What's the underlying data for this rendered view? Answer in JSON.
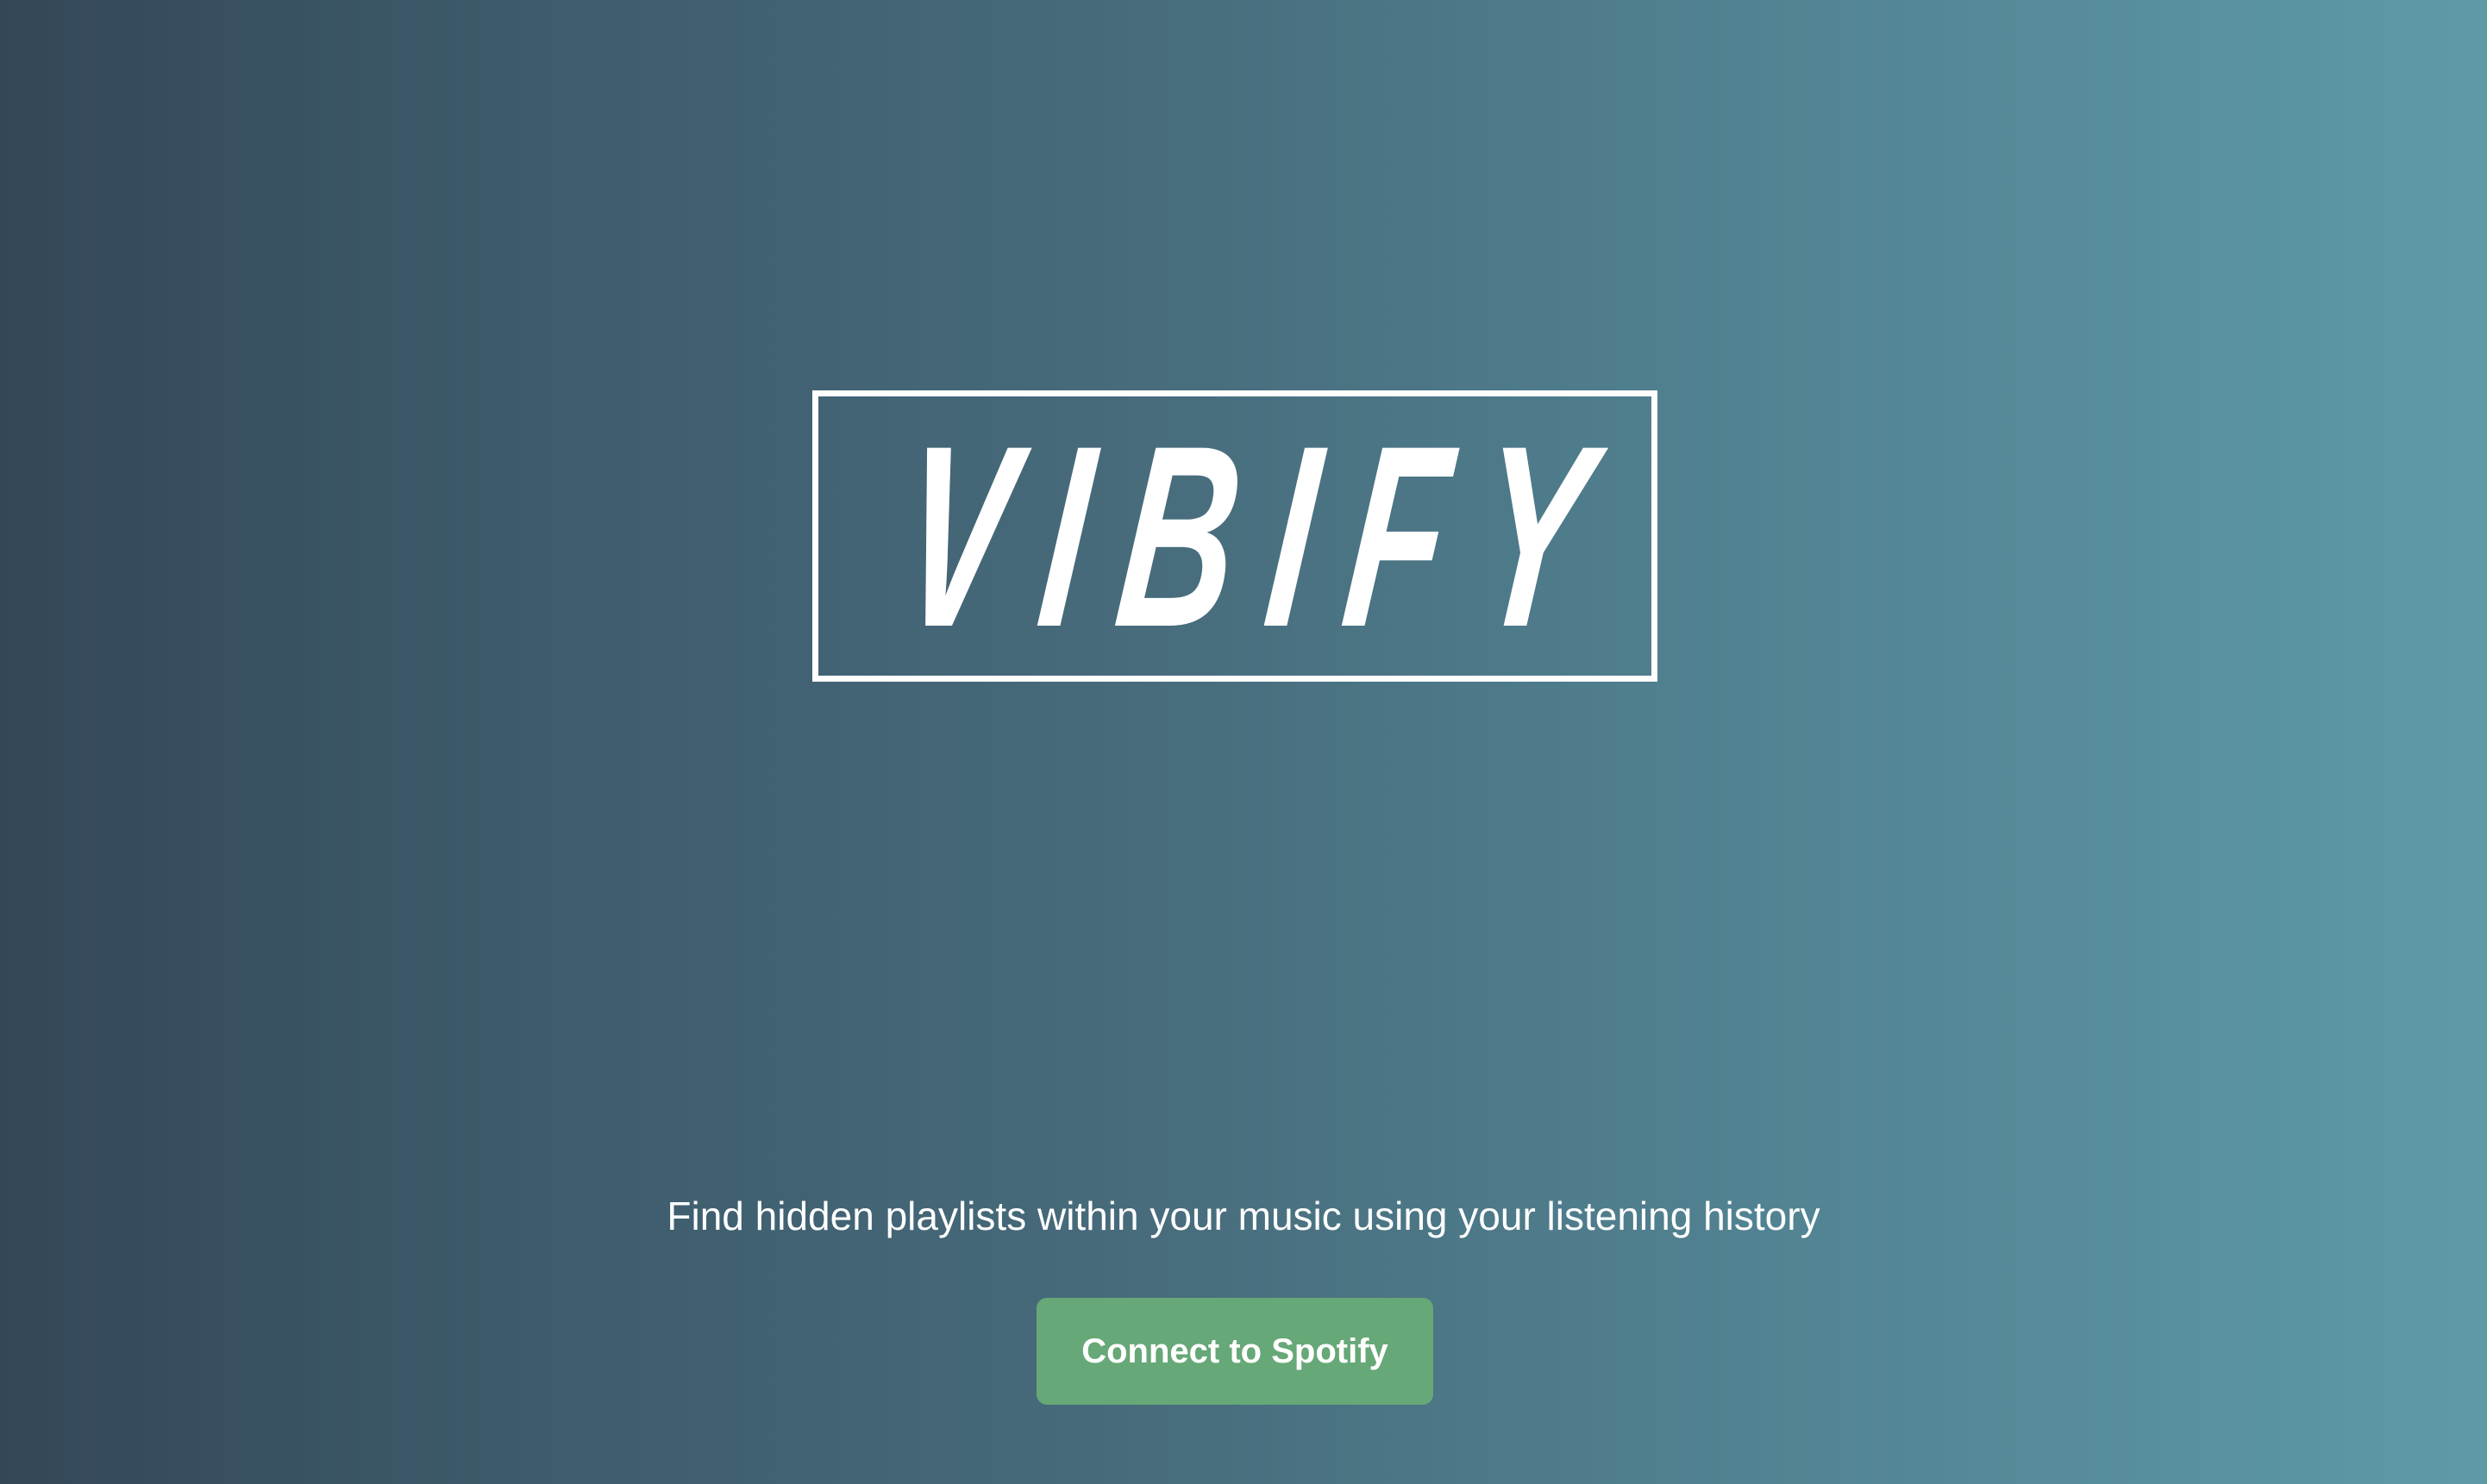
{
  "logo": {
    "text": "VIBIFY"
  },
  "tagline": "Find hidden playlists within your music using your listening history",
  "cta": {
    "label": "Connect to Spotify"
  },
  "colors": {
    "button_green": "#66a877",
    "text": "#ffffff",
    "gradient_start": "#344757",
    "gradient_end": "#5e9aa6"
  }
}
